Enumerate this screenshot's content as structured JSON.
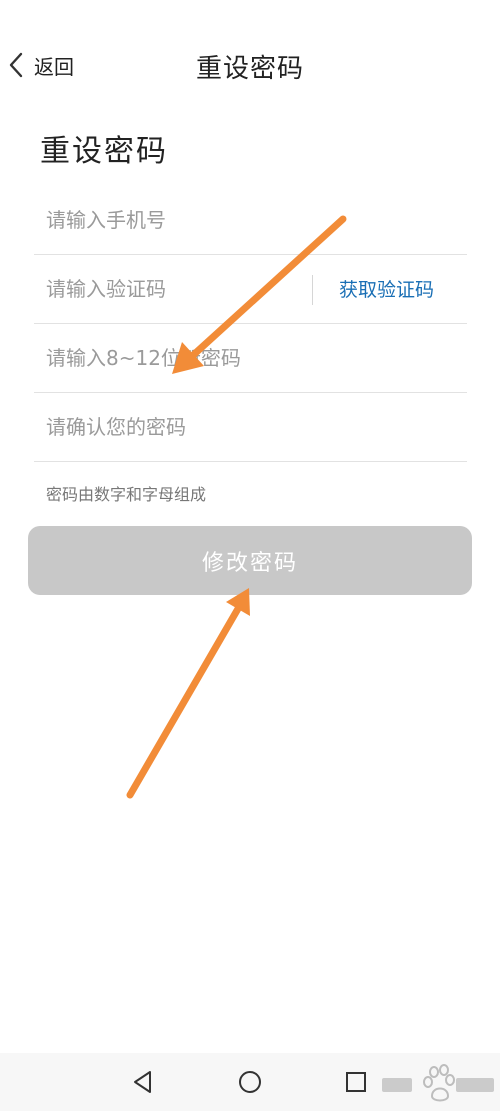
{
  "header": {
    "back_label": "返回",
    "title": "重设密码"
  },
  "page": {
    "heading": "重设密码"
  },
  "form": {
    "phone_placeholder": "请输入手机号",
    "code_placeholder": "请输入验证码",
    "get_code_label": "获取验证码",
    "new_password_placeholder": "请输入8~12位新密码",
    "confirm_password_placeholder": "请确认您的密码",
    "hint": "密码由数字和字母组成",
    "submit_label": "修改密码"
  },
  "nav": {
    "icons": [
      "back-triangle-icon",
      "home-circle-icon",
      "recents-square-icon"
    ]
  },
  "colors": {
    "link": "#1a6fb5",
    "button_disabled": "#c8c8c8",
    "annotation_arrow": "#f28c38"
  }
}
